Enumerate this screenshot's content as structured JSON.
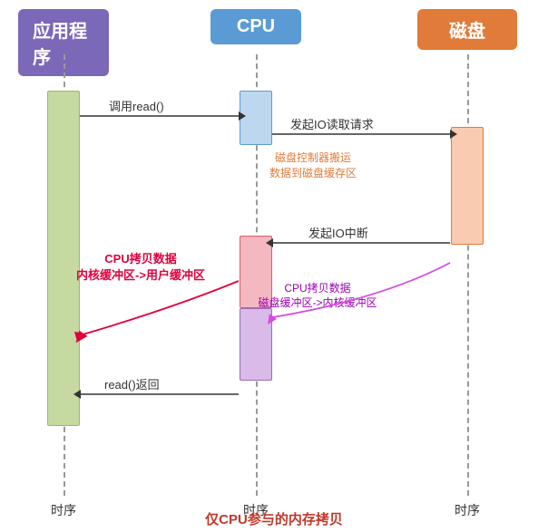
{
  "headers": {
    "app": "应用程序",
    "cpu": "CPU",
    "disk": "磁盘"
  },
  "timeLabels": {
    "app": "时序",
    "cpu": "时序",
    "disk": "时序"
  },
  "arrows": {
    "call_read": "调用read()",
    "io_read_request": "发起IO读取请求",
    "io_interrupt": "发起IO中断",
    "read_return": "read()返回",
    "disk_controller": "磁盘控制器搬运\n数据到磁盘缓存区",
    "cpu_copy_kernel": "CPU拷贝数据\n内核缓冲区->用户缓冲区",
    "cpu_copy_disk": "CPU拷贝数据\n磁盘缓冲区->内核缓冲区"
  },
  "caption": "仅CPU参与的内存拷贝"
}
